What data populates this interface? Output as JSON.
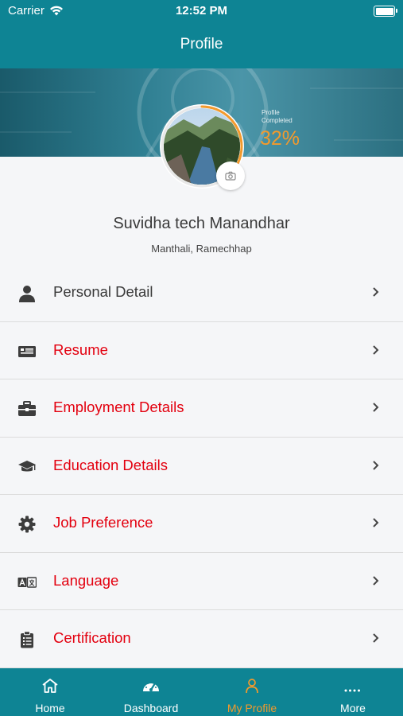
{
  "status_bar": {
    "carrier": "Carrier",
    "time": "12:52 PM"
  },
  "header": {
    "title": "Profile"
  },
  "profile": {
    "progress_label": "Profile Completed",
    "progress_percent": "32%",
    "progress_fraction": 0.32,
    "name": "Suvidha tech Manandhar",
    "location": "Manthali, Ramechhap"
  },
  "menu": {
    "items": [
      {
        "label": "Personal Detail",
        "icon": "person-icon"
      },
      {
        "label": "Resume",
        "icon": "resume-icon"
      },
      {
        "label": "Employment Details",
        "icon": "briefcase-icon"
      },
      {
        "label": "Education Details",
        "icon": "graduation-cap-icon"
      },
      {
        "label": "Job Preference",
        "icon": "gear-icon"
      },
      {
        "label": "Language",
        "icon": "language-icon"
      },
      {
        "label": "Certification",
        "icon": "clipboard-icon"
      }
    ]
  },
  "tabs": [
    {
      "label": "Home",
      "icon": "home-icon"
    },
    {
      "label": "Dashboard",
      "icon": "speedometer-icon"
    },
    {
      "label": "My Profile",
      "icon": "user-icon",
      "active": true
    },
    {
      "label": "More",
      "icon": "more-dots-icon"
    }
  ],
  "colors": {
    "primary": "#0e8494",
    "accent": "#f39a2c",
    "alert_text": "#e3000f"
  }
}
